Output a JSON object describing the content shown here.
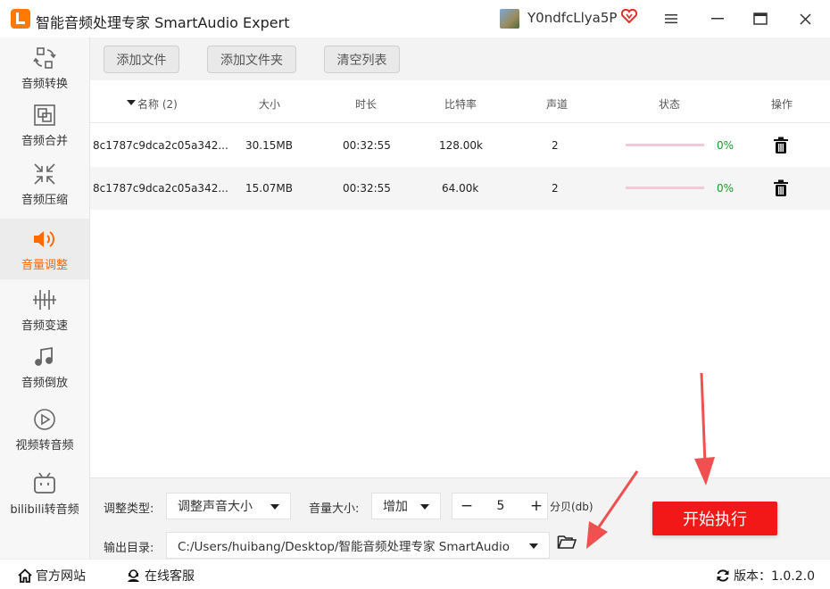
{
  "app": {
    "title": "智能音频处理专家 SmartAudio Expert",
    "username": "Y0ndfcLlya5P"
  },
  "sidebar": {
    "items": [
      {
        "label": "音频转换",
        "icon": "convert-icon",
        "active": false
      },
      {
        "label": "音频合并",
        "icon": "merge-icon",
        "active": false
      },
      {
        "label": "音频压缩",
        "icon": "compress-icon",
        "active": false
      },
      {
        "label": "音量调整",
        "icon": "volume-icon",
        "active": true
      },
      {
        "label": "音频变速",
        "icon": "speed-icon",
        "active": false
      },
      {
        "label": "音频倒放",
        "icon": "music-note-icon",
        "active": false
      },
      {
        "label": "视频转音频",
        "icon": "play-circle-icon",
        "active": false
      },
      {
        "label": "bilibili转音频",
        "icon": "bilibili-tv-icon",
        "active": false
      }
    ]
  },
  "toolbar": {
    "add_file": "添加文件",
    "add_folder": "添加文件夹",
    "clear_list": "清空列表"
  },
  "table": {
    "columns": {
      "name": "名称 (2)",
      "size": "大小",
      "duration": "时长",
      "bitrate": "比特率",
      "channels": "声道",
      "status": "状态",
      "actions": "操作"
    },
    "rows": [
      {
        "name": "8c1787c9dca2c05a342...",
        "size": "30.15MB",
        "duration": "00:32:55",
        "bitrate": "128.00k",
        "channels": "2",
        "progress": "0%"
      },
      {
        "name": "8c1787c9dca2c05a342...",
        "size": "15.07MB",
        "duration": "00:32:55",
        "bitrate": "64.00k",
        "channels": "2",
        "progress": "0%"
      }
    ]
  },
  "settings": {
    "adjust_type_label": "调整类型:",
    "adjust_type_value": "调整声音大小",
    "volume_label": "音量大小:",
    "volume_mode": "增加",
    "volume_value": "5",
    "unit": "分贝(db)",
    "output_label": "输出目录:",
    "output_path": "C:/Users/huibang/Desktop/智能音频处理专家 SmartAudio",
    "start_button": "开始执行"
  },
  "statusbar": {
    "website": "官方网站",
    "support": "在线客服",
    "version": "版本：1.0.2.0"
  },
  "colors": {
    "accent": "#ff6a00",
    "start_button": "#f21818",
    "progress_text": "#1a9a2a",
    "annotation_arrow": "#f05050"
  }
}
